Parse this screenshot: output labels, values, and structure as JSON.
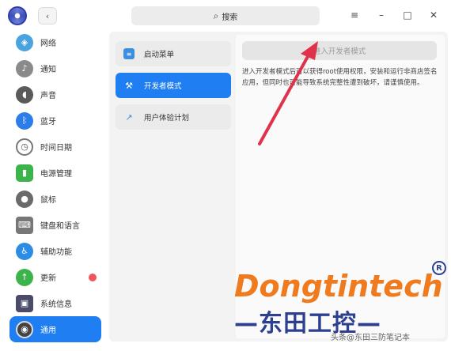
{
  "window": {
    "search_icon": "search-icon",
    "search_label": "搜索",
    "menu_icon": "≡",
    "minimize_icon": "–",
    "maximize_icon": "□",
    "close_icon": "✕",
    "back_icon": "‹"
  },
  "sidebar": {
    "items": [
      {
        "label": "网络",
        "icon": "network-icon",
        "color": "#4aa3df"
      },
      {
        "label": "通知",
        "icon": "bell-icon",
        "color": "#7a7a7a"
      },
      {
        "label": "声音",
        "icon": "speaker-icon",
        "color": "#5a5a5a"
      },
      {
        "label": "蓝牙",
        "icon": "bluetooth-icon",
        "color": "#2b7de9"
      },
      {
        "label": "时间日期",
        "icon": "clock-icon",
        "color": "#888888"
      },
      {
        "label": "电源管理",
        "icon": "battery-icon",
        "color": "#3cb44b"
      },
      {
        "label": "鼠标",
        "icon": "mouse-icon",
        "color": "#666666"
      },
      {
        "label": "键盘和语言",
        "icon": "keyboard-icon",
        "color": "#777777"
      },
      {
        "label": "辅助功能",
        "icon": "accessibility-icon",
        "color": "#2d8de4"
      },
      {
        "label": "更新",
        "icon": "update-icon",
        "color": "#3cb44b",
        "badge": true
      },
      {
        "label": "系统信息",
        "icon": "system-info-icon",
        "color": "#4a4a6a"
      },
      {
        "label": "通用",
        "icon": "general-icon",
        "color": "#555555",
        "active": true
      }
    ]
  },
  "submenu": {
    "items": [
      {
        "label": "启动菜单",
        "icon": "boot-menu-icon"
      },
      {
        "label": "开发者模式",
        "icon": "developer-tools-icon",
        "active": true
      },
      {
        "label": "用户体验计划",
        "icon": "chart-trend-icon"
      }
    ]
  },
  "content": {
    "enter_dev_button": "进入开发者模式",
    "description": "进入开发者模式后可以获得root使用权限，安装和运行非商店签名应用，但同时也可能导致系统完整性遭到破坏，请谨慎使用。"
  },
  "watermark": {
    "brand": "Dongtintech",
    "reg": "R",
    "chinese": "—东田工控—",
    "credit": "头条@东田三防笔记本"
  },
  "colors": {
    "accent": "#1f7ef2",
    "arrow": "#e0324b",
    "brand_orange": "#f07a1e",
    "brand_navy": "#2d3f8f",
    "badge_red": "#f0555d"
  }
}
